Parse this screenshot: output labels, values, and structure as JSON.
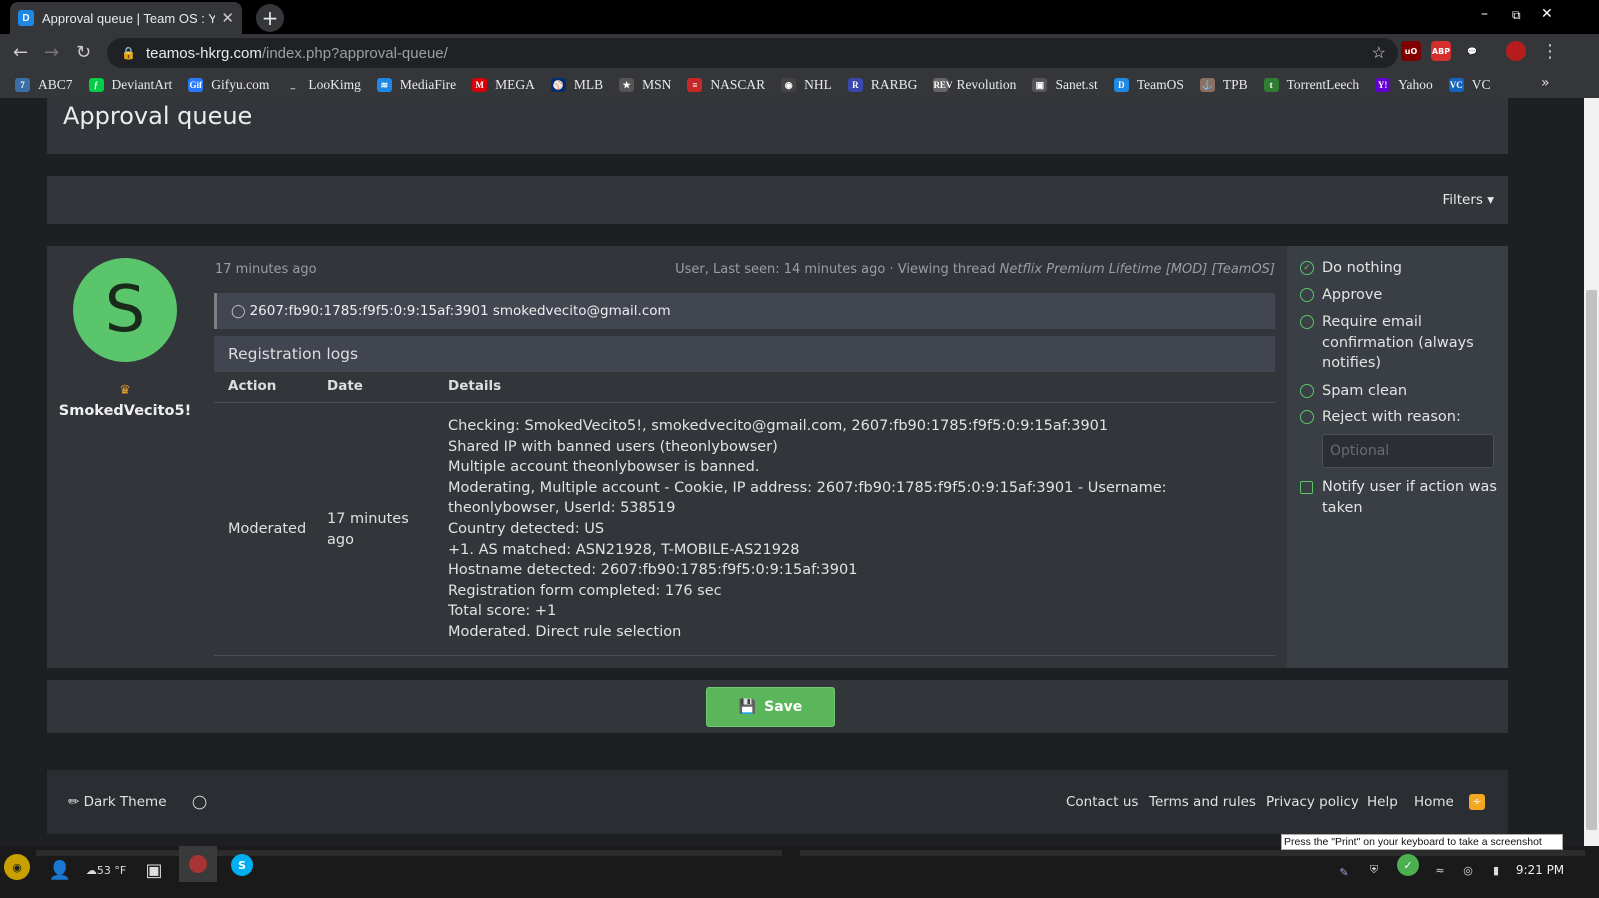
{
  "browser": {
    "tab_title": "Approval queue | Team OS : Y",
    "tab_favicon_letter": "D",
    "new_tab": "+",
    "url_domain": "teamos-hkrg.com",
    "url_path": "/index.php?approval-queue/",
    "window_controls": {
      "minimize": "–",
      "maximize": "⧉",
      "close": "✕"
    },
    "extensions": [
      {
        "name": "ublock-icon",
        "label": "uO",
        "color": "#800000"
      },
      {
        "name": "adblock-plus-icon",
        "label": "ABP",
        "color": "#d32f2f"
      },
      {
        "name": "chat-extension-icon",
        "label": "💬",
        "color": "#35363a"
      },
      {
        "name": "profile-avatar-icon",
        "label": "",
        "color": "#b71c1c"
      }
    ],
    "bookmarks": [
      {
        "label": "ABC7",
        "icon": "abc7-icon",
        "color": "#3a6ea5",
        "glyph": "7"
      },
      {
        "label": "DeviantArt",
        "icon": "deviantart-icon",
        "color": "#05cc47",
        "glyph": "ƒ"
      },
      {
        "label": "Gifyu.com",
        "icon": "gifyu-icon",
        "color": "#2979ff",
        "glyph": "Gif"
      },
      {
        "label": "LooKimg",
        "icon": "lookimg-icon",
        "color": "#35363a",
        "glyph": "_"
      },
      {
        "label": "MediaFire",
        "icon": "mediafire-icon",
        "color": "#1e88e5",
        "glyph": "≋"
      },
      {
        "label": "MEGA",
        "icon": "mega-icon",
        "color": "#d90007",
        "glyph": "M"
      },
      {
        "label": "MLB",
        "icon": "mlb-icon",
        "color": "#002d72",
        "glyph": "⚾"
      },
      {
        "label": "MSN",
        "icon": "msn-icon",
        "color": "#555",
        "glyph": "★"
      },
      {
        "label": "NASCAR",
        "icon": "nascar-icon",
        "color": "#c62828",
        "glyph": "≡"
      },
      {
        "label": "NHL",
        "icon": "nhl-icon",
        "color": "#444",
        "glyph": "◉"
      },
      {
        "label": "RARBG",
        "icon": "rarbg-icon",
        "color": "#3949ab",
        "glyph": "R"
      },
      {
        "label": "Revolution",
        "icon": "revolution-icon",
        "color": "#666",
        "glyph": "REV"
      },
      {
        "label": "Sanet.st",
        "icon": "sanet-icon",
        "color": "#555",
        "glyph": "▣"
      },
      {
        "label": "TeamOS",
        "icon": "teamos-icon",
        "color": "#1e88e5",
        "glyph": "D"
      },
      {
        "label": "TPB",
        "icon": "tpb-icon",
        "color": "#8d6e63",
        "glyph": "⚓"
      },
      {
        "label": "TorrentLeech",
        "icon": "torrentleech-icon",
        "color": "#2e7d32",
        "glyph": "t"
      },
      {
        "label": "Yahoo",
        "icon": "yahoo-icon",
        "color": "#6001d2",
        "glyph": "Y!"
      },
      {
        "label": "VC",
        "icon": "vc-icon",
        "color": "#1565c0",
        "glyph": "VC"
      }
    ],
    "bookmarks_more": "»"
  },
  "page": {
    "title": "Approval queue",
    "filters_label": "Filters",
    "avatar_letter": "S",
    "username": "SmokedVecito5!",
    "time_ago": "17 minutes ago",
    "user_status_prefix": "User, Last seen: 14 minutes ago · Viewing thread",
    "user_status_thread": "Netflix Premium Lifetime [MOD] [TeamOS]",
    "ip_address": "2607:fb90:1785:f9f5:0:9:15af:3901",
    "email": "smokedvecito@gmail.com",
    "registration_logs_title": "Registration logs",
    "columns": {
      "action": "Action",
      "date": "Date",
      "details": "Details"
    },
    "log_row": {
      "action": "Moderated",
      "date": "17 minutes ago",
      "details": [
        "Checking: SmokedVecito5!, smokedvecito@gmail.com, 2607:fb90:1785:f9f5:0:9:15af:3901",
        "Shared IP with banned users (theonlybowser)",
        "Multiple account theonlybowser is banned.",
        "Moderating, Multiple account - Cookie, IP address: 2607:fb90:1785:f9f5:0:9:15af:3901 - Username: theonlybowser, UserId: 538519",
        "Country detected: US",
        "+1. AS matched: ASN21928, T-MOBILE-AS21928",
        "Hostname detected: 2607:fb90:1785:f9f5:0:9:15af:3901",
        "Registration form completed: 176 sec",
        "Total score: +1",
        "Moderated. Direct rule selection"
      ]
    },
    "actions": {
      "do_nothing": "Do nothing",
      "approve": "Approve",
      "require_email": "Require email confirmation (always notifies)",
      "spam_clean": "Spam clean",
      "reject": "Reject with reason:",
      "reason_placeholder": "Optional",
      "notify": "Notify user if action was taken",
      "selected": "do_nothing"
    },
    "save_label": "Save"
  },
  "footer": {
    "theme_label": "Dark Theme",
    "links": [
      "Contact us",
      "Terms and rules",
      "Privacy policy",
      "Help",
      "Home"
    ]
  },
  "taskbar": {
    "weather": "53 °F",
    "time": "9:21 PM",
    "tooltip": "Press the \"Print\" on your keyboard to take a screenshot"
  },
  "colors": {
    "accent_green": "#5bc56b",
    "panel": "#32353a",
    "background": "#1d1f22"
  }
}
